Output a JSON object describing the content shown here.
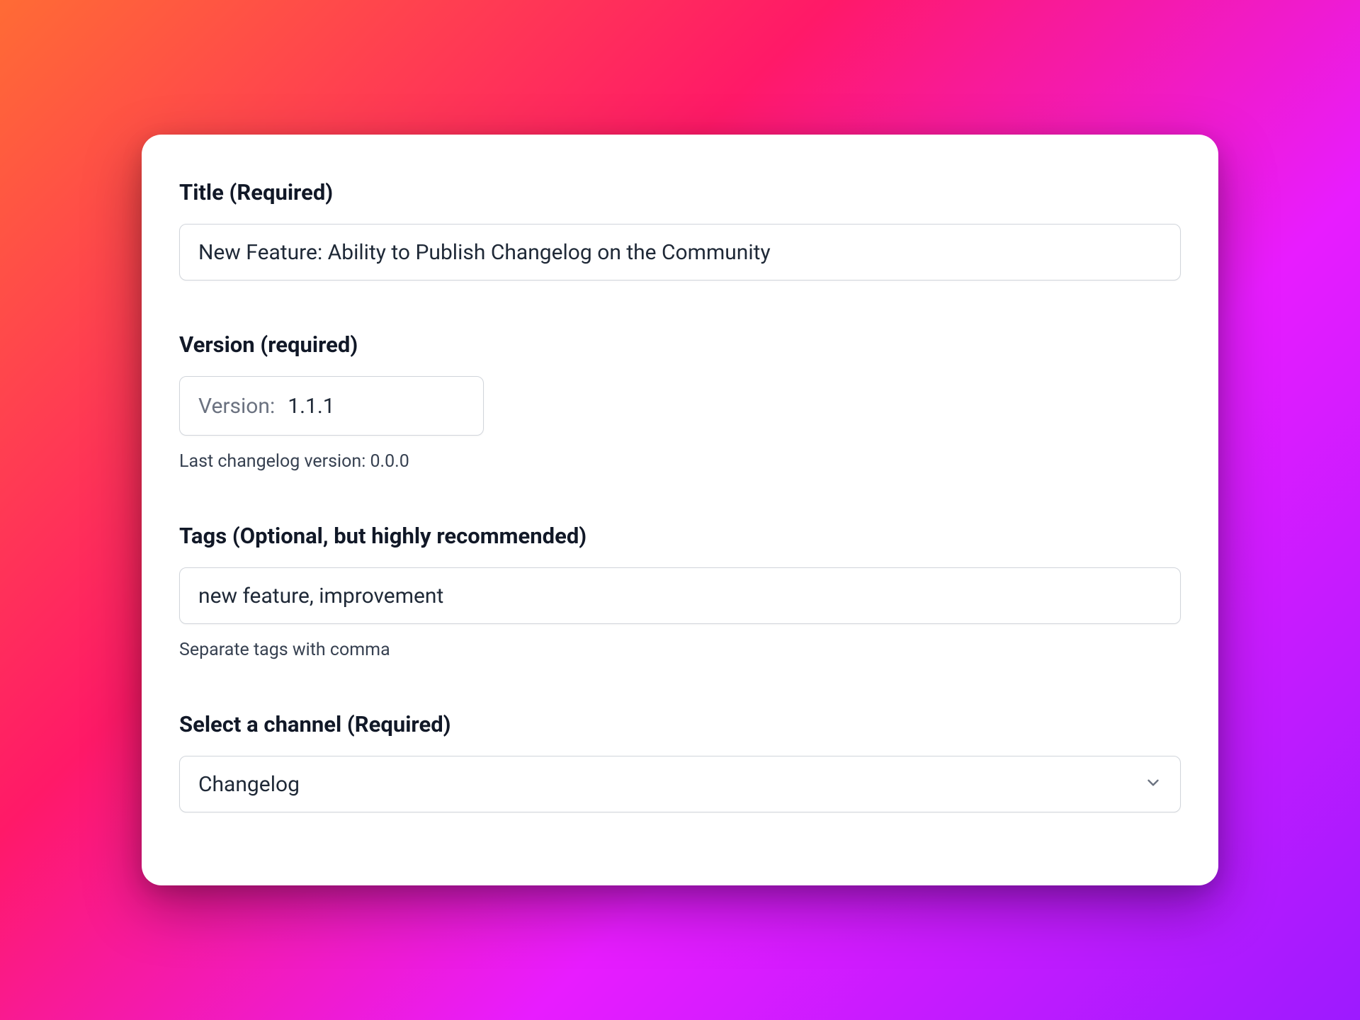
{
  "form": {
    "title": {
      "label": "Title (Required)",
      "value": "New Feature: Ability to Publish Changelog on the Community"
    },
    "version": {
      "label": "Version (required)",
      "prefix": "Version:",
      "value": "1.1.1",
      "helper": "Last changelog version: 0.0.0"
    },
    "tags": {
      "label": "Tags (Optional, but highly recommended)",
      "value": "new feature, improvement",
      "helper": "Separate tags with comma"
    },
    "channel": {
      "label": "Select a channel (Required)",
      "selected": "Changelog"
    }
  }
}
